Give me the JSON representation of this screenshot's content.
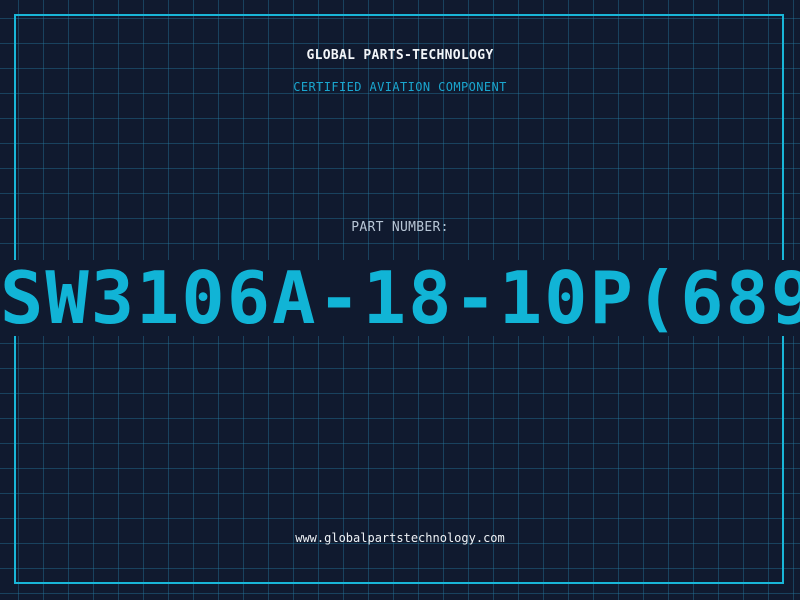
{
  "header": {
    "company": "GLOBAL PARTS-TECHNOLOGY",
    "tagline": "CERTIFIED AVIATION COMPONENT"
  },
  "part": {
    "label": "PART NUMBER:",
    "number": "SW3106A-18-10P(689"
  },
  "footer": {
    "url": "www.globalpartstechnology.com"
  },
  "colors": {
    "background": "#101a2f",
    "grid": "#2882aa",
    "accent": "#11b4d6",
    "text": "#f2f5f8"
  }
}
